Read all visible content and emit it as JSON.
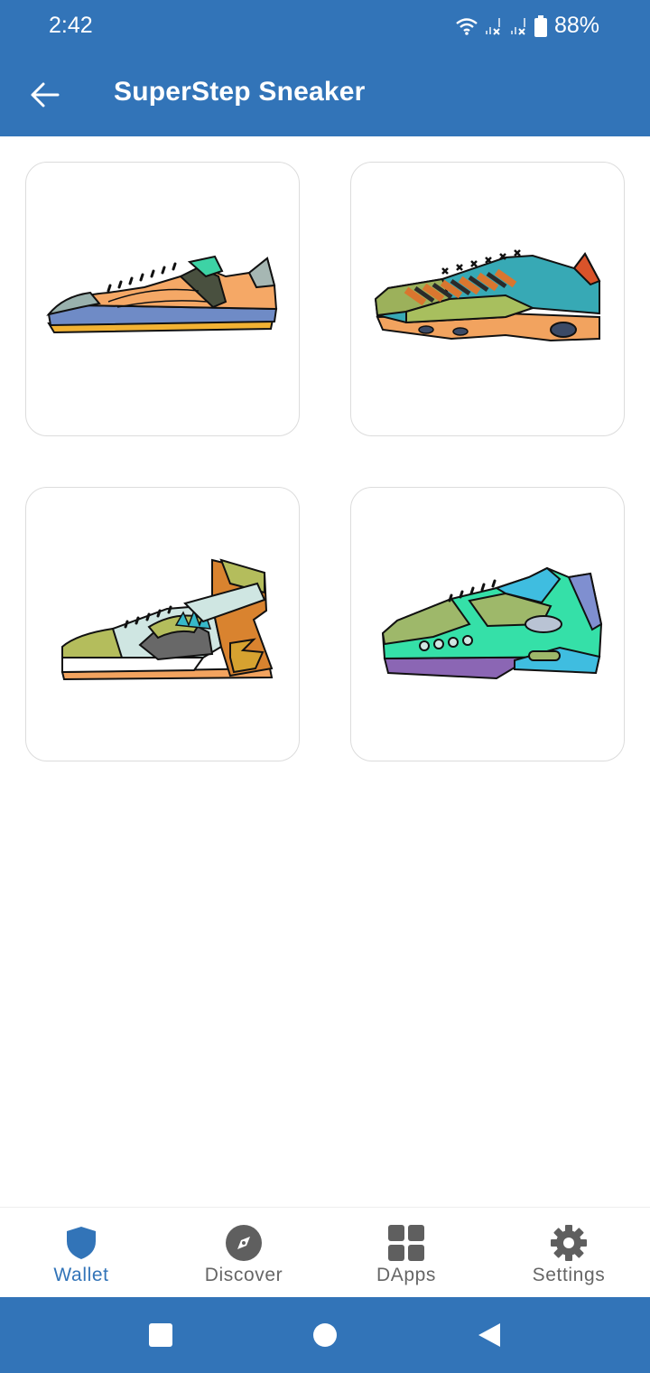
{
  "status_bar": {
    "time": "2:42",
    "battery": "88%",
    "icons": [
      "wifi-icon",
      "signal-x-icon",
      "signal-x-icon",
      "battery-icon"
    ]
  },
  "app_bar": {
    "title": "SuperStep Sneaker",
    "back_icon": "arrow-left-icon"
  },
  "sneakers": [
    {
      "name": "sneaker-low-orange"
    },
    {
      "name": "sneaker-runner-teal-orange"
    },
    {
      "name": "sneaker-high-top-olive"
    },
    {
      "name": "sneaker-air-green-blue"
    }
  ],
  "bottom_nav": [
    {
      "label": "Wallet",
      "icon": "shield-icon",
      "active": true
    },
    {
      "label": "Discover",
      "icon": "compass-icon",
      "active": false
    },
    {
      "label": "DApps",
      "icon": "grid-icon",
      "active": false
    },
    {
      "label": "Settings",
      "icon": "gear-icon",
      "active": false
    }
  ],
  "system_nav": [
    "recents-square-icon",
    "home-circle-icon",
    "back-triangle-icon"
  ],
  "colors": {
    "primary": "#3274b8",
    "nav_inactive": "#666666",
    "card_border": "#dcdcdc"
  }
}
